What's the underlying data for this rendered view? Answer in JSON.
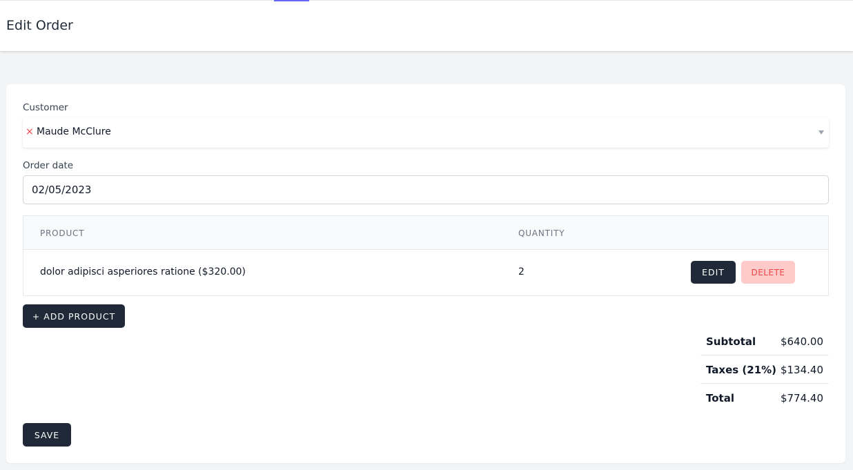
{
  "header": {
    "title": "Edit Order"
  },
  "form": {
    "customer_label": "Customer",
    "customer_value": "Maude McClure",
    "clear_symbol": "×",
    "order_date_label": "Order date",
    "order_date_value": "02/05/2023"
  },
  "table": {
    "headers": {
      "product": "Product",
      "quantity": "Quantity"
    },
    "rows": [
      {
        "product": "dolor adipisci asperiores ratione ($320.00)",
        "quantity": "2",
        "edit_label": "Edit",
        "delete_label": "Delete"
      }
    ]
  },
  "actions": {
    "add_product_label": "+ Add Product",
    "save_label": "Save"
  },
  "totals": {
    "subtotal_label": "Subtotal",
    "subtotal_value": "$640.00",
    "taxes_label": "Taxes (21%)",
    "taxes_value": "$134.40",
    "total_label": "Total",
    "total_value": "$774.40"
  },
  "colors": {
    "primary_button": "#1f2937",
    "danger_bg": "#fecaca",
    "danger_text": "#ef4444",
    "accent": "#6366f1"
  },
  "icons": {
    "clear": "close-icon",
    "dropdown": "chevron-down-icon"
  }
}
